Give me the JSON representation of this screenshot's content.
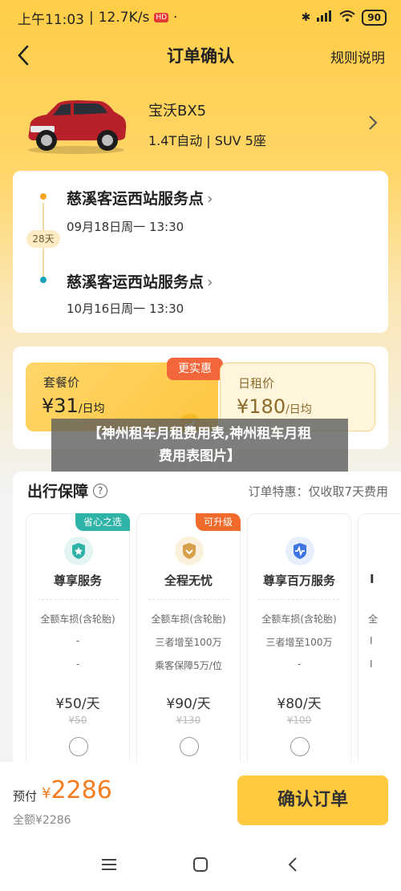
{
  "status": {
    "time": "上午11:03",
    "speed": "12.7K/s",
    "hd_badge": "HD",
    "dot": "·",
    "battery": "90"
  },
  "nav": {
    "title": "订单确认",
    "rules": "规则说明"
  },
  "car": {
    "name": "宝沃BX5",
    "spec": "1.4T自动 | SUV 5座"
  },
  "trip": {
    "pickup_location": "慈溪客运西站服务点",
    "pickup_time": "09月18日周一 13:30",
    "duration": "28天",
    "return_location": "慈溪客运西站服务点",
    "return_time": "10月16日周一 13:30"
  },
  "pricing": {
    "plan_a": {
      "title": "套餐价",
      "currency": "¥",
      "amount": "31",
      "unit": "/日均",
      "badge": "更实惠"
    },
    "plan_b": {
      "title": "日租价",
      "currency": "¥",
      "amount": "180",
      "unit": "/日均"
    }
  },
  "banner": {
    "line1": "【神州租车月租费用表,神州租车月租",
    "line2": "费用表图片】"
  },
  "protection": {
    "title": "出行保障",
    "note": "订单特惠：仅收取7天费用",
    "cards": [
      {
        "tag": "省心之选",
        "name": "尊享服务",
        "features": [
          "全额车损(含轮胎)",
          "-",
          "-"
        ],
        "price": "¥50/天",
        "original": "¥50"
      },
      {
        "tag": "可升级",
        "name": "全程无忧",
        "features": [
          "全额车损(含轮胎)",
          "三者增至100万",
          "乘客保障5万/位"
        ],
        "price": "¥90/天",
        "original": "¥130"
      },
      {
        "tag": "",
        "name": "尊享百万服务",
        "features": [
          "全额车损(含轮胎)",
          "三者增至100万",
          "-"
        ],
        "price": "¥80/天",
        "original": "¥100"
      },
      {
        "tag": "",
        "name": "I",
        "features": [
          "全",
          "I",
          "I"
        ],
        "price": "",
        "original": ""
      }
    ]
  },
  "bottom": {
    "prepay_label": "预付",
    "prepay_currency": "¥",
    "prepay_amount": "2286",
    "full_label": "全额¥2286",
    "confirm": "确认订单"
  },
  "colors": {
    "brand": "#ffc940",
    "accent_orange": "#f57c1f",
    "tag_teal": "#2fb3a6",
    "tag_orange": "#ef6a2b"
  }
}
